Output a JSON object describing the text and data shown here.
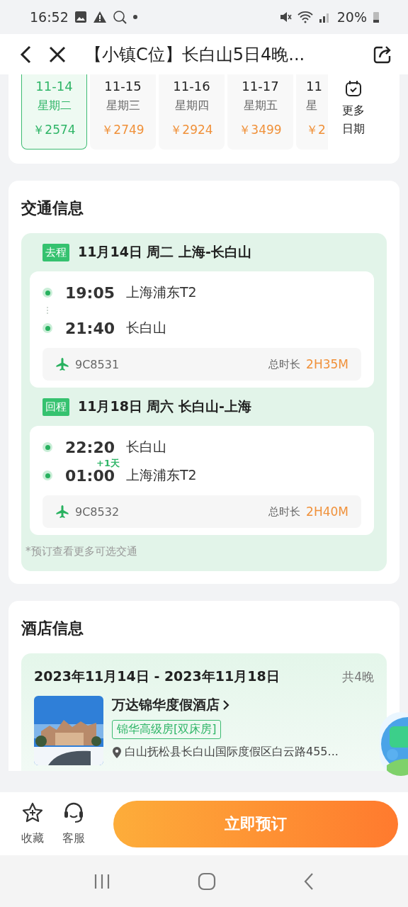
{
  "status_bar": {
    "time": "16:52",
    "battery": "20%"
  },
  "header": {
    "title": "【小镇C位】长白山5日4晚..."
  },
  "dates": [
    {
      "date": "11-14",
      "weekday": "星期二",
      "price": "￥2574",
      "selected": true
    },
    {
      "date": "11-15",
      "weekday": "星期三",
      "price": "￥2749",
      "selected": false
    },
    {
      "date": "11-16",
      "weekday": "星期四",
      "price": "￥2924",
      "selected": false
    },
    {
      "date": "11-17",
      "weekday": "星期五",
      "price": "￥3499",
      "selected": false
    },
    {
      "date": "11",
      "weekday": "星",
      "price": "￥2",
      "selected": false
    }
  ],
  "more_dates": "更多日期",
  "transport": {
    "title": "交通信息",
    "legs": [
      {
        "tag": "去程",
        "heading": "11月14日 周二 上海-长白山",
        "depart_time": "19:05",
        "depart_place": "上海浦东T2",
        "arrive_time": "21:40",
        "arrive_place": "长白山",
        "flight": "9C8531",
        "duration_label": "总时长",
        "duration": "2H35M"
      },
      {
        "tag": "回程",
        "heading": "11月18日 周六 长白山-上海",
        "depart_time": "22:20",
        "depart_place": "长白山",
        "next_day": "+1天",
        "arrive_time": "01:00",
        "arrive_place": "上海浦东T2",
        "flight": "9C8532",
        "duration_label": "总时长",
        "duration": "2H40M"
      }
    ],
    "note": "*预订查看更多可选交通"
  },
  "hotel": {
    "title": "酒店信息",
    "dates": "2023年11月14日 - 2023年11月18日",
    "nights": "共4晚",
    "name": "万达锦华度假酒店",
    "room": "锦华高级房[双床房]",
    "address": "白山抚松县长白山国际度假区白云路455..."
  },
  "bottom_bar": {
    "actions": [
      {
        "label": "收藏",
        "kind": "favorite"
      },
      {
        "label": "客服",
        "kind": "service"
      }
    ],
    "book": "立即预订"
  }
}
